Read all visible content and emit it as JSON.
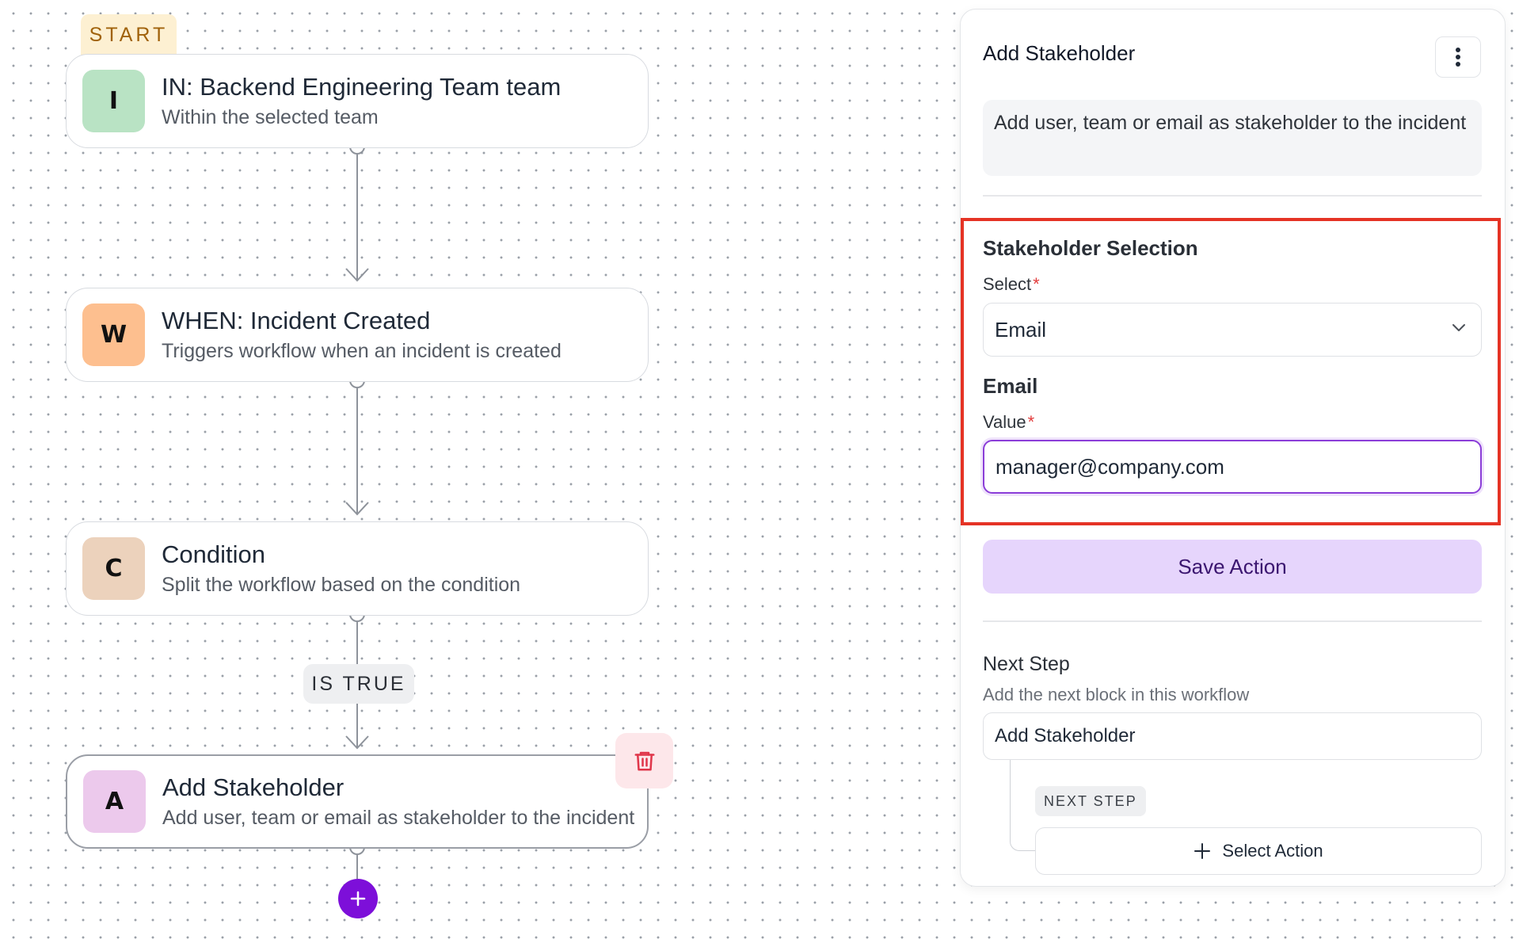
{
  "workflow": {
    "start_label": "START",
    "nodes": [
      {
        "badge": "I",
        "badge_color": "#b9e3c4",
        "title": "IN: Backend Engineering Team team",
        "subtitle": "Within the selected team"
      },
      {
        "badge": "W",
        "badge_color": "#fdbf8f",
        "title": "WHEN: Incident Created",
        "subtitle": "Triggers workflow when an incident is created"
      },
      {
        "badge": "C",
        "badge_color": "#ecd2bc",
        "title": "Condition",
        "subtitle": "Split the workflow based on the condition"
      },
      {
        "badge": "A",
        "badge_color": "#ecc9ec",
        "title": "Add Stakeholder",
        "subtitle": "Add user, team or email as stakeholder to the incident"
      }
    ],
    "branch_label": "IS TRUE",
    "delete_icon": "trash-icon",
    "add_icon": "plus-icon"
  },
  "panel": {
    "title": "Add Stakeholder",
    "menu_icon": "kebab-menu-icon",
    "description": "Add user, team or email as stakeholder to the incident",
    "selection_heading": "Stakeholder Selection",
    "select_label": "Select",
    "select_value": "Email",
    "email_heading": "Email",
    "value_label": "Value",
    "value_input": "manager@company.com",
    "required_mark": "*",
    "save_label": "Save Action",
    "next_step_title": "Next Step",
    "next_step_subtitle": "Add the next block in this workflow",
    "next_block_label": "Add Stakeholder",
    "next_step_tag": "NEXT STEP",
    "select_action_label": "Select Action"
  },
  "colors": {
    "accent": "#7d0fd9",
    "save_button_bg": "#e6d5fc",
    "highlight": "#e53325",
    "delete_bg": "#fde7ea"
  }
}
